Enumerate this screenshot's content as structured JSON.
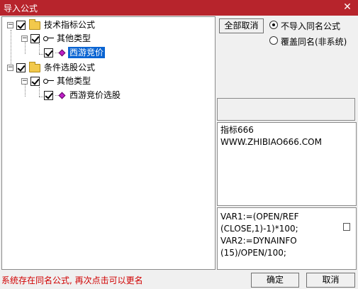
{
  "window": {
    "title": "导入公式",
    "close_glyph": "✕"
  },
  "tree": {
    "nodes": [
      {
        "label": "技术指标公式"
      },
      {
        "label": "其他类型"
      },
      {
        "label": "西游竞价",
        "selected": true
      },
      {
        "label": "条件选股公式"
      },
      {
        "label": "其他类型"
      },
      {
        "label": "西游竞价选股"
      }
    ],
    "expander_glyph": "−"
  },
  "options": {
    "deselect_all_label": "全部取消",
    "radio_no_import": "不导入同名公式",
    "radio_overwrite": "覆盖同名(非系统)",
    "selected": "radio_no_import"
  },
  "info": {
    "text": "指标666\nWWW.ZHIBIAO666.COM"
  },
  "formula": {
    "text": "VAR1:=(OPEN/REF\n(CLOSE,1)-1)*100;\nVAR2:=DYNAINFO\n(15)/OPEN/100;"
  },
  "footer": {
    "status": "系统存在同名公式, 再次点击可以更名",
    "ok_label": "确定",
    "cancel_label": "取消"
  },
  "colors": {
    "titlebar": "#b7242c",
    "selection": "#0a64d2",
    "status": "#d00000"
  }
}
